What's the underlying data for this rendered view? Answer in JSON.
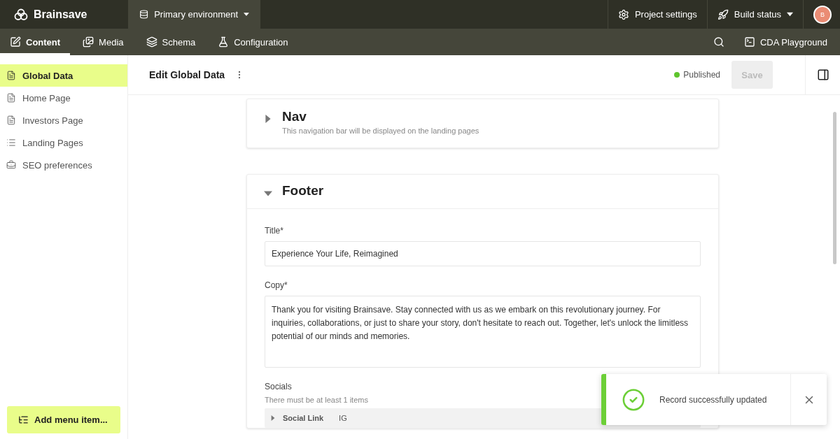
{
  "brand": {
    "name": "Brainsave"
  },
  "environment": {
    "label": "Primary environment"
  },
  "top_actions": [
    {
      "kind": "settings",
      "label": "Project settings"
    },
    {
      "kind": "build",
      "label": "Build status"
    }
  ],
  "avatar": {
    "initial": "B"
  },
  "tabs": [
    {
      "kind": "content",
      "label": "Content",
      "selected": true
    },
    {
      "kind": "media",
      "label": "Media",
      "selected": false
    },
    {
      "kind": "schema",
      "label": "Schema",
      "selected": false
    },
    {
      "kind": "config",
      "label": "Configuration",
      "selected": false
    }
  ],
  "playground": {
    "label": "CDA Playground"
  },
  "sidebar": {
    "items": [
      {
        "kind": "page",
        "label": "Global Data",
        "selected": true
      },
      {
        "kind": "page",
        "label": "Home Page",
        "selected": false
      },
      {
        "kind": "page",
        "label": "Investors Page",
        "selected": false
      },
      {
        "kind": "list",
        "label": "Landing Pages",
        "selected": false
      },
      {
        "kind": "seo",
        "label": "SEO preferences",
        "selected": false
      }
    ],
    "add_button": "Add menu item..."
  },
  "editor": {
    "title": "Edit Global Data",
    "status": "Published",
    "save": "Save",
    "save_disabled": true
  },
  "sections": [
    {
      "title": "Nav",
      "hint": "This navigation bar will be displayed on the landing pages",
      "expanded": false
    },
    {
      "title": "Footer",
      "expanded": true,
      "fields": [
        {
          "kind": "input",
          "label": "Title*",
          "value": "Experience Your Life, Reimagined"
        },
        {
          "kind": "textarea",
          "label": "Copy*",
          "value": "Thank you for visiting Brainsave. Stay connected with us as we embark on this revolutionary journey. For inquiries, collaborations, or just to share your story, don't hesitate to reach out. Together, let's unlock the limitless potential of our minds and memories."
        },
        {
          "kind": "blocks",
          "label": "Socials",
          "hint": "There must be at least 1 items",
          "items": [
            {
              "type": "Social Link",
              "value": "IG"
            }
          ]
        }
      ]
    }
  ],
  "toast": {
    "message": "Record successfully updated"
  }
}
